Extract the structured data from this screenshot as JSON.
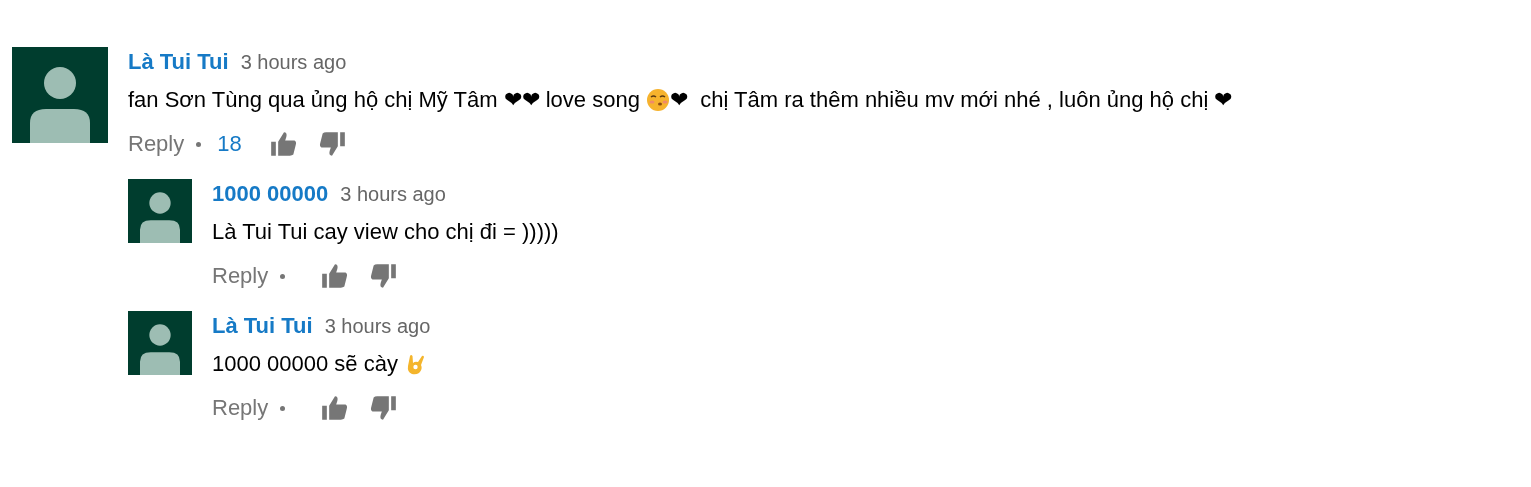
{
  "comments": [
    {
      "author": "Là Tui Tui",
      "time": "3 hours ago",
      "body": [
        {
          "kind": "text",
          "text": "fan Sơn Tùng qua ủng hộ chị Mỹ Tâm ❤❤ love song "
        },
        {
          "kind": "kiss-emoji"
        },
        {
          "kind": "text",
          "text": "❤  chị Tâm ra thêm nhiều mv mới nhé , luôn ủng hộ chị ❤"
        }
      ],
      "reply_label": "Reply",
      "likes": "18",
      "replies": [
        {
          "author": "1000 00000",
          "time": "3 hours ago",
          "body": [
            {
              "kind": "text",
              "text": "Là Tui Tui cay view cho chị đi = )))))"
            }
          ],
          "reply_label": "Reply"
        },
        {
          "author": "Là Tui Tui",
          "time": "3 hours ago",
          "body": [
            {
              "kind": "text",
              "text": "1000 00000 sẽ cày "
            },
            {
              "kind": "ok-emoji"
            }
          ],
          "reply_label": "Reply"
        }
      ]
    }
  ]
}
